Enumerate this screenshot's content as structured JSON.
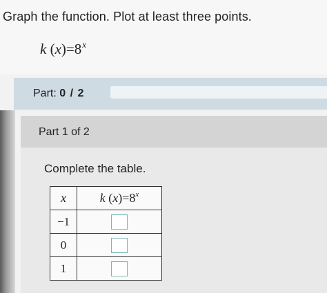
{
  "question": {
    "text": "Graph the function. Plot at least three points."
  },
  "function": {
    "name": "k",
    "var": "x",
    "equals": "=",
    "base": "8",
    "exponent": "x"
  },
  "part_bar": {
    "label": "Part:",
    "progress_text": "0 / 2",
    "progress_fraction": 0.0,
    "accent": "#3b7fb4"
  },
  "part": {
    "header": "Part 1 of 2",
    "instruction": "Complete the table."
  },
  "table": {
    "header_x": "x",
    "header_fn": {
      "name": "k",
      "var": "x",
      "equals": "=",
      "base": "8",
      "exponent": "x"
    },
    "rows": [
      {
        "x": "−1",
        "value": ""
      },
      {
        "x": "0",
        "value": ""
      },
      {
        "x": "1",
        "value": ""
      }
    ]
  }
}
